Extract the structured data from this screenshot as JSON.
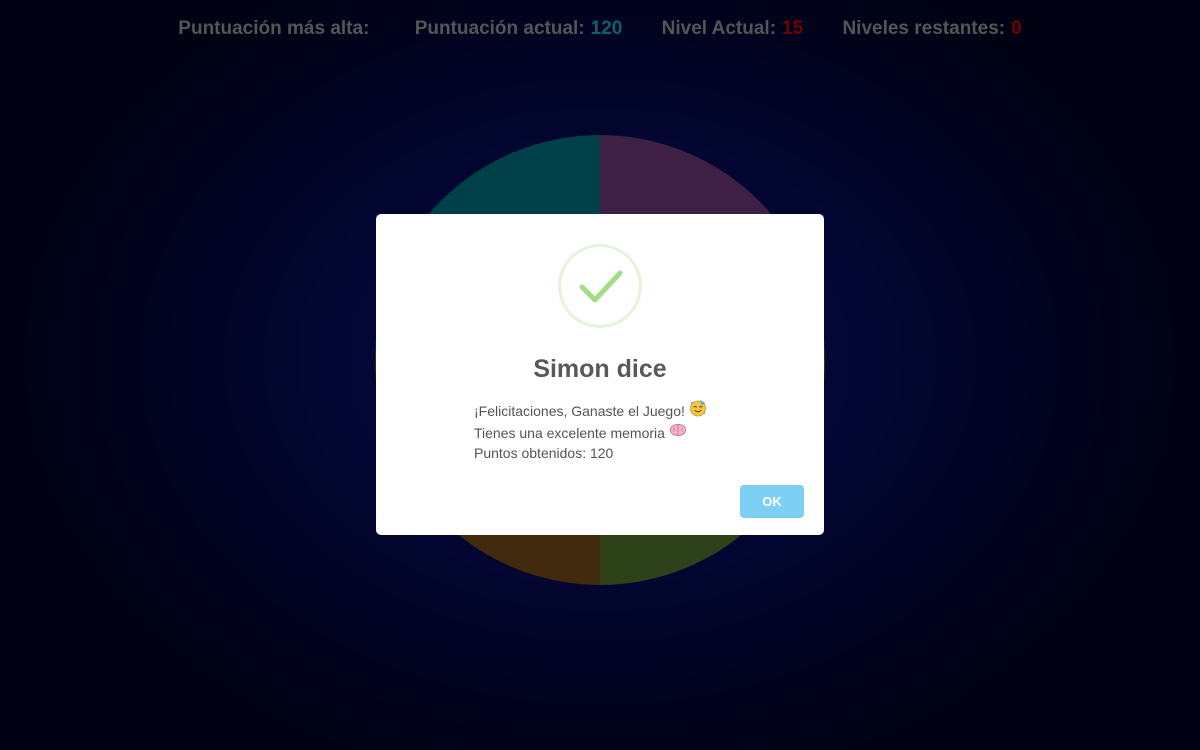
{
  "scoreboard": {
    "high_score_label": "Puntuación más alta:",
    "high_score_value": "",
    "current_score_label": "Puntuación actual:",
    "current_score_value": "120",
    "current_level_label": "Nivel Actual:",
    "current_level_value": "15",
    "remaining_levels_label": "Niveles restantes:",
    "remaining_levels_value": "0",
    "current_score_color": "#17a2b8",
    "level_color": "#c00000"
  },
  "board": {
    "quadrants": [
      {
        "name": "teal",
        "color": "#006b7a"
      },
      {
        "name": "purple",
        "color": "#673670"
      },
      {
        "name": "orange",
        "color": "#6c4516"
      },
      {
        "name": "green",
        "color": "#4b6e2a"
      }
    ]
  },
  "modal": {
    "icon": "checkmark-success-icon",
    "title": "Simon dice",
    "line1": "¡Felicitaciones, Ganaste el Juego!",
    "line1_icon": "party-face-emoji-icon",
    "line2": "Tienes una excelente memoria",
    "line2_icon": "brain-emoji-icon",
    "line3": "Puntos obtenidos: 120",
    "ok_label": "OK",
    "ok_color": "#7ecff4",
    "check_color": "#a5dc86"
  }
}
